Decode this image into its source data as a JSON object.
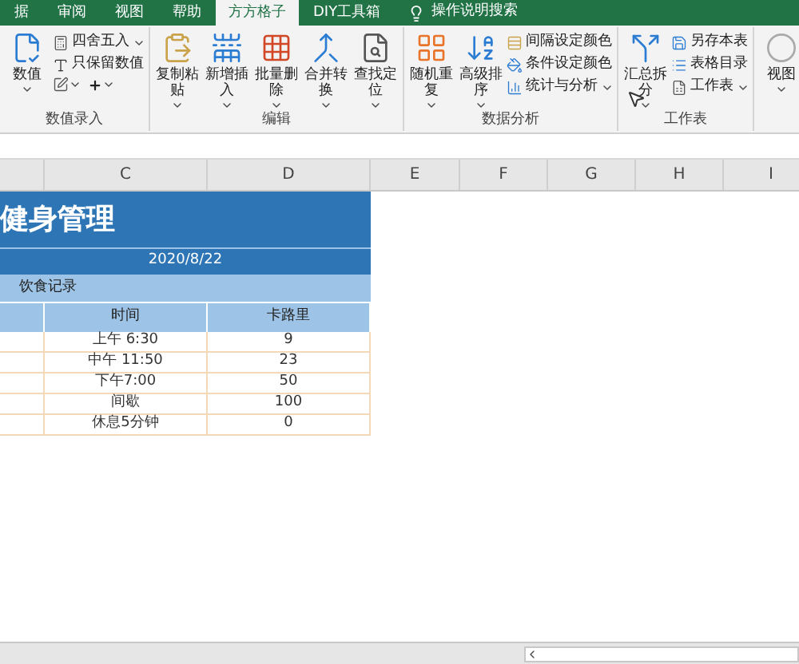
{
  "tabs": [
    {
      "label": "据",
      "selected": false
    },
    {
      "label": "审阅",
      "selected": false
    },
    {
      "label": "视图",
      "selected": false
    },
    {
      "label": "帮助",
      "selected": false
    },
    {
      "label": "方方格子",
      "selected": true
    },
    {
      "label": "DIY工具箱",
      "selected": false
    }
  ],
  "search": {
    "label": "操作说明搜索"
  },
  "ribbon_groups": [
    {
      "label": "数值录入",
      "items": [
        {
          "kind": "large",
          "label": "数值",
          "dropdown": true
        },
        {
          "kind": "small",
          "label": "四舍五入",
          "dropdown": true
        },
        {
          "kind": "small",
          "label": "只保留数值",
          "dropdown": false
        },
        {
          "kind": "icons",
          "dropdown": true
        }
      ]
    },
    {
      "label": "编辑",
      "items": [
        {
          "kind": "large",
          "label": "复制粘贴",
          "dropdown": true
        },
        {
          "kind": "large",
          "label": "新增插入",
          "dropdown": true
        },
        {
          "kind": "large",
          "label": "批量删除",
          "dropdown": true
        },
        {
          "kind": "large",
          "label": "合并转换",
          "dropdown": true
        },
        {
          "kind": "large",
          "label": "查找定位",
          "dropdown": true
        }
      ]
    },
    {
      "label": "数据分析",
      "items": [
        {
          "kind": "large",
          "label": "随机重复",
          "dropdown": true
        },
        {
          "kind": "large",
          "label": "高级排序",
          "dropdown": true
        },
        {
          "kind": "small",
          "label": "间隔设定颜色",
          "dropdown": false
        },
        {
          "kind": "small",
          "label": "条件设定颜色",
          "dropdown": false
        },
        {
          "kind": "small",
          "label": "统计与分析",
          "dropdown": true
        }
      ]
    },
    {
      "label": "工作表",
      "items": [
        {
          "kind": "large",
          "label": "汇总拆分",
          "dropdown": true
        },
        {
          "kind": "small",
          "label": "另存本表",
          "dropdown": false
        },
        {
          "kind": "small",
          "label": "表格目录",
          "dropdown": false
        },
        {
          "kind": "small",
          "label": "工作表",
          "dropdown": true
        }
      ]
    },
    {
      "items": [
        {
          "kind": "large",
          "label": "视图",
          "dropdown": true
        }
      ]
    }
  ],
  "columns": [
    "C",
    "D",
    "E",
    "F",
    "G",
    "H",
    "I"
  ],
  "sheet": {
    "title": "健身管理",
    "date": "2020/8/22",
    "section": "饮食记录",
    "headers": [
      "时间",
      "卡路里"
    ],
    "rows": [
      [
        "上午 6:30",
        "9"
      ],
      [
        "中午 11:50",
        "23"
      ],
      [
        "下午7:00",
        "50"
      ],
      [
        "间歇",
        "100"
      ],
      [
        "休息5分钟",
        "0"
      ]
    ]
  }
}
